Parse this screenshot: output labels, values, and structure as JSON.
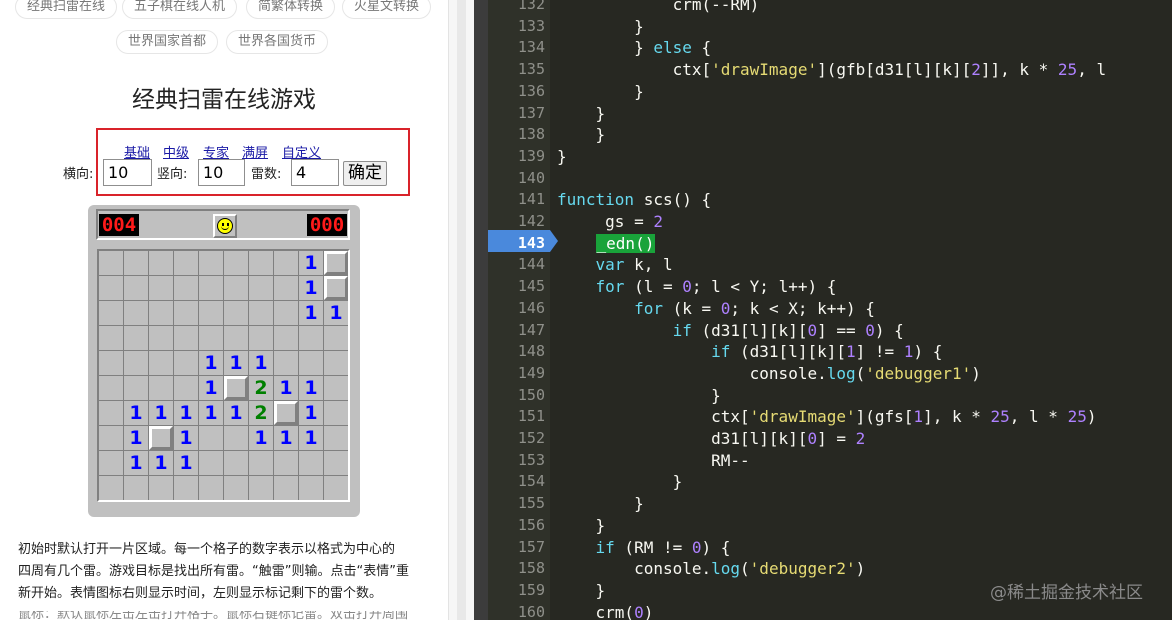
{
  "tabs": [
    {
      "label": "经典扫雷在线"
    },
    {
      "label": "五子棋在线人机"
    },
    {
      "label": "简繁体转换"
    },
    {
      "label": "火星文转换"
    },
    {
      "label": "世界国家首都"
    },
    {
      "label": "世界各国货币"
    }
  ],
  "page": {
    "title": "经典扫雷在线游戏"
  },
  "levels": [
    {
      "label": "基础"
    },
    {
      "label": "中级"
    },
    {
      "label": "专家"
    },
    {
      "label": "满屏"
    },
    {
      "label": "自定义"
    }
  ],
  "controls": {
    "horizontal_label": "横向:",
    "horizontal_value": "10",
    "vertical_label": "竖向:",
    "vertical_value": "10",
    "mines_label": "雷数:",
    "mines_value": "4",
    "confirm_label": "确定"
  },
  "game": {
    "mine_counter": "004",
    "timer": "000",
    "grid": [
      "         #",
      "         #",
      "                ",
      "",
      "",
      "",
      "",
      "",
      "",
      ""
    ],
    "cells": [
      {
        "r": 0,
        "c": 8,
        "t": "1"
      },
      {
        "r": 0,
        "c": 9,
        "t": "#"
      },
      {
        "r": 1,
        "c": 8,
        "t": "1"
      },
      {
        "r": 1,
        "c": 9,
        "t": "#"
      },
      {
        "r": 2,
        "c": 8,
        "t": "1"
      },
      {
        "r": 2,
        "c": 9,
        "t": "1"
      },
      {
        "r": 4,
        "c": 4,
        "t": "1"
      },
      {
        "r": 4,
        "c": 5,
        "t": "1"
      },
      {
        "r": 4,
        "c": 6,
        "t": "1"
      },
      {
        "r": 5,
        "c": 4,
        "t": "1"
      },
      {
        "r": 5,
        "c": 5,
        "t": "#"
      },
      {
        "r": 5,
        "c": 6,
        "t": "2"
      },
      {
        "r": 5,
        "c": 7,
        "t": "1"
      },
      {
        "r": 5,
        "c": 8,
        "t": "1"
      },
      {
        "r": 6,
        "c": 1,
        "t": "1"
      },
      {
        "r": 6,
        "c": 2,
        "t": "1"
      },
      {
        "r": 6,
        "c": 3,
        "t": "1"
      },
      {
        "r": 6,
        "c": 4,
        "t": "1"
      },
      {
        "r": 6,
        "c": 5,
        "t": "1"
      },
      {
        "r": 6,
        "c": 6,
        "t": "2"
      },
      {
        "r": 6,
        "c": 7,
        "t": "#"
      },
      {
        "r": 6,
        "c": 8,
        "t": "1"
      },
      {
        "r": 7,
        "c": 1,
        "t": "1"
      },
      {
        "r": 7,
        "c": 2,
        "t": "#"
      },
      {
        "r": 7,
        "c": 3,
        "t": "1"
      },
      {
        "r": 7,
        "c": 6,
        "t": "1"
      },
      {
        "r": 7,
        "c": 7,
        "t": "1"
      },
      {
        "r": 7,
        "c": 8,
        "t": "1"
      },
      {
        "r": 8,
        "c": 1,
        "t": "1"
      },
      {
        "r": 8,
        "c": 2,
        "t": "1"
      },
      {
        "r": 8,
        "c": 3,
        "t": "1"
      }
    ]
  },
  "description": {
    "line1": "初始时默认打开一片区域。每一个格子的数字表示以格式为中心的",
    "line2": "四周有几个雷。游戏目标是找出所有雷。“触雷”则输。点击“表情”重",
    "line3": "新开始。表情图标右则显示时间，左则显示标记剩下的雷个数。",
    "line4": "鼠标：默认鼠标左击左击打开格子。鼠标右键标记雷。双击打开周围"
  },
  "editor": {
    "first_line": 132,
    "breakpoint_line": 143,
    "lines": [
      [
        {
          "t": "            crm(--RM)"
        }
      ],
      [
        {
          "t": "        }"
        }
      ],
      [
        {
          "t": "        } "
        },
        {
          "t": "else",
          "k": "kw"
        },
        {
          "t": " {"
        }
      ],
      [
        {
          "t": "            ctx["
        },
        {
          "t": "'drawImage'",
          "k": "str"
        },
        {
          "t": "](gfb[d31[l][k]["
        },
        {
          "t": "2",
          "k": "num"
        },
        {
          "t": "]], k * "
        },
        {
          "t": "25",
          "k": "num"
        },
        {
          "t": ", l"
        }
      ],
      [
        {
          "t": "        }"
        }
      ],
      [
        {
          "t": "    }"
        }
      ],
      [
        {
          "t": "    }"
        }
      ],
      [
        {
          "t": "}"
        }
      ],
      [
        {
          "t": ""
        }
      ],
      [
        {
          "t": "function",
          "k": "kw"
        },
        {
          "t": " scs() {"
        }
      ],
      [
        {
          "t": "     gs = "
        },
        {
          "t": "2",
          "k": "num"
        }
      ],
      [
        {
          "t": "    "
        },
        {
          "t": "_edn()",
          "k": "hl"
        }
      ],
      [
        {
          "t": "    "
        },
        {
          "t": "var",
          "k": "kw"
        },
        {
          "t": " k, l"
        }
      ],
      [
        {
          "t": "    "
        },
        {
          "t": "for",
          "k": "kw"
        },
        {
          "t": " (l = "
        },
        {
          "t": "0",
          "k": "num"
        },
        {
          "t": "; l < Y; l++) {"
        }
      ],
      [
        {
          "t": "        "
        },
        {
          "t": "for",
          "k": "kw"
        },
        {
          "t": " (k = "
        },
        {
          "t": "0",
          "k": "num"
        },
        {
          "t": "; k < X; k++) {"
        }
      ],
      [
        {
          "t": "            "
        },
        {
          "t": "if",
          "k": "kw"
        },
        {
          "t": " (d31[l][k]["
        },
        {
          "t": "0",
          "k": "num"
        },
        {
          "t": "] == "
        },
        {
          "t": "0",
          "k": "num"
        },
        {
          "t": ") {"
        }
      ],
      [
        {
          "t": "                "
        },
        {
          "t": "if",
          "k": "kw"
        },
        {
          "t": " (d31[l][k]["
        },
        {
          "t": "1",
          "k": "num"
        },
        {
          "t": "] != "
        },
        {
          "t": "1",
          "k": "num"
        },
        {
          "t": ") {"
        }
      ],
      [
        {
          "t": "                    console."
        },
        {
          "t": "log",
          "k": "kw"
        },
        {
          "t": "("
        },
        {
          "t": "'debugger1'",
          "k": "str"
        },
        {
          "t": ")"
        }
      ],
      [
        {
          "t": "                }"
        }
      ],
      [
        {
          "t": "                ctx["
        },
        {
          "t": "'drawImage'",
          "k": "str"
        },
        {
          "t": "](gfs["
        },
        {
          "t": "1",
          "k": "num"
        },
        {
          "t": "], k * "
        },
        {
          "t": "25",
          "k": "num"
        },
        {
          "t": ", l * "
        },
        {
          "t": "25",
          "k": "num"
        },
        {
          "t": ")"
        }
      ],
      [
        {
          "t": "                d31[l][k]["
        },
        {
          "t": "0",
          "k": "num"
        },
        {
          "t": "] = "
        },
        {
          "t": "2",
          "k": "num"
        }
      ],
      [
        {
          "t": "                RM--"
        }
      ],
      [
        {
          "t": "            }"
        }
      ],
      [
        {
          "t": "        }"
        }
      ],
      [
        {
          "t": "    }"
        }
      ],
      [
        {
          "t": "    "
        },
        {
          "t": "if",
          "k": "kw"
        },
        {
          "t": " (RM != "
        },
        {
          "t": "0",
          "k": "num"
        },
        {
          "t": ") {"
        }
      ],
      [
        {
          "t": "        console."
        },
        {
          "t": "log",
          "k": "kw"
        },
        {
          "t": "("
        },
        {
          "t": "'debugger2'",
          "k": "str"
        },
        {
          "t": ")"
        }
      ],
      [
        {
          "t": "    }"
        }
      ],
      [
        {
          "t": "    crm("
        },
        {
          "t": "0",
          "k": "num"
        },
        {
          "t": ")"
        }
      ]
    ]
  },
  "watermark": "@稀土掘金技术社区",
  "colors": {
    "editor_bg": "#272822",
    "keyword": "#66d9ef",
    "string": "#e6db74",
    "number": "#ae81ff",
    "highlight": "#19a33a",
    "breakpoint": "#4a89dc",
    "frame_red": "#d9232a"
  }
}
